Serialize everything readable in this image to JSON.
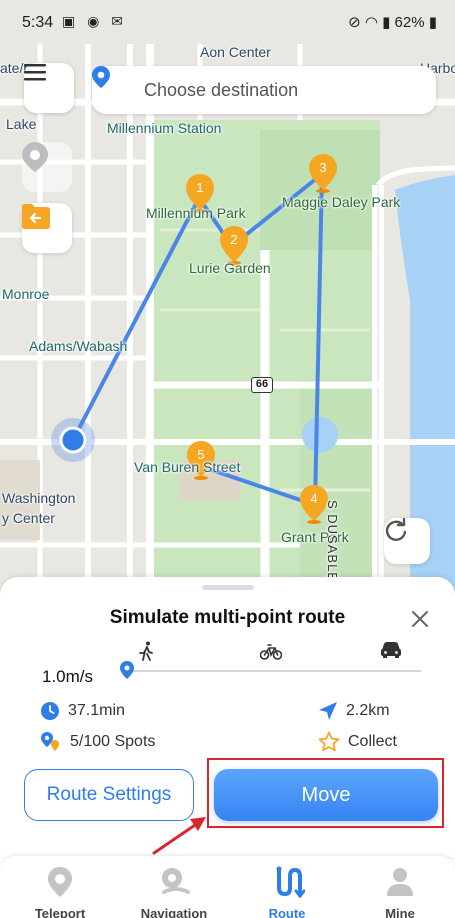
{
  "status_bar": {
    "time": "5:34",
    "left_icons": [
      "image-icon",
      "location-icon",
      "app-icon"
    ],
    "battery": "62%"
  },
  "search": {
    "placeholder": "Choose destination"
  },
  "map": {
    "labels": {
      "aon_center": "Aon Center",
      "millennium_station": "Millennium Station",
      "millennium_park": "Millennium Park",
      "lurie_garden": "Lurie Garden",
      "maggie_daley_park": "Maggie Daley Park",
      "monroe": "Monroe",
      "adams_wabash": "Adams/Wabash",
      "van_buren_street": "Van Buren Street",
      "washington": "Washington",
      "library_center": "y Center",
      "grant_park": "Grant Park",
      "s_dusable_lake": "S DUSABLE LAKE",
      "lake": "Lake",
      "ate_port": "ate/port",
      "harbo": "Harbo",
      "route_66": "66"
    },
    "waypoints": [
      "1",
      "2",
      "3",
      "4",
      "5"
    ]
  },
  "sheet": {
    "title": "Simulate multi-point route",
    "speed": "1.0m/s",
    "speed_level": 0.0,
    "modes": [
      "walk-icon",
      "bike-icon",
      "car-icon"
    ],
    "duration": "37.1min",
    "distance": "2.2km",
    "spots": "5/100 Spots",
    "collect_label": "Collect",
    "route_settings_label": "Route Settings",
    "move_label": "Move"
  },
  "tabs": [
    {
      "label": "Teleport",
      "icon": "location-pin-icon",
      "active": false
    },
    {
      "label": "Navigation",
      "icon": "navigation-icon",
      "active": false
    },
    {
      "label": "Route",
      "icon": "route-icon",
      "active": true
    },
    {
      "label": "Mine",
      "icon": "profile-icon",
      "active": false
    }
  ],
  "colors": {
    "accent": "#2f7de9",
    "route_line": "#4a86e8",
    "waypoint": "#f5a623",
    "highlight": "#d9262c",
    "park": "#c8e6c0"
  }
}
